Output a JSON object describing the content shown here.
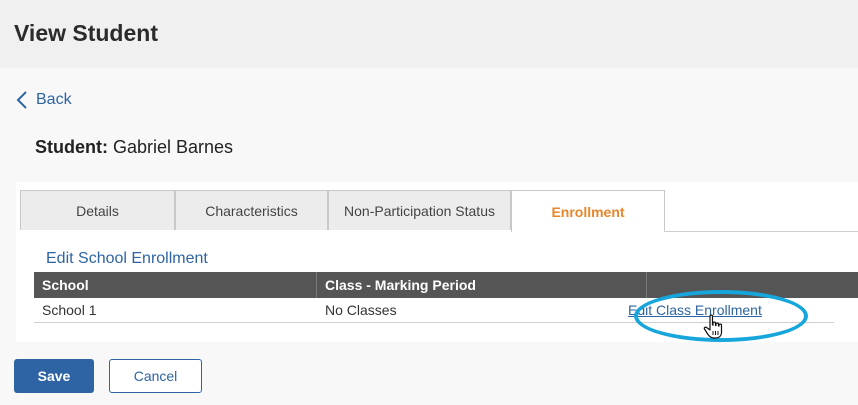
{
  "header": {
    "title": "View Student"
  },
  "nav": {
    "back_label": "Back"
  },
  "student": {
    "label": "Student:",
    "name": "Gabriel Barnes"
  },
  "tabs": [
    {
      "label": "Details"
    },
    {
      "label": "Characteristics"
    },
    {
      "label": "Non-Participation Status"
    },
    {
      "label": "Enrollment",
      "active": true
    }
  ],
  "enrollment": {
    "edit_school_label": "Edit School Enrollment",
    "columns": [
      "School",
      "Class - Marking Period",
      ""
    ],
    "rows": [
      {
        "school": "School 1",
        "class_marking_period": "No Classes",
        "action_label": "Edit Class Enrollment"
      }
    ]
  },
  "footer": {
    "save_label": "Save",
    "cancel_label": "Cancel"
  },
  "colors": {
    "accent": "#2e64a3",
    "active_tab": "#e8862a",
    "highlight": "#16a6dc",
    "header_row": "#555555"
  }
}
